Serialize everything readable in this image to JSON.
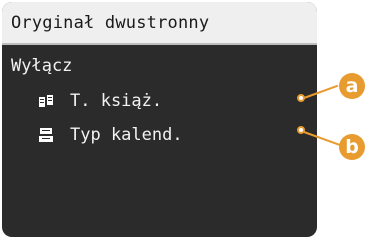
{
  "screen": {
    "title": "Oryginał dwustronny",
    "current_value": "Wyłącz",
    "options": [
      {
        "label": "T. książ.",
        "icon": "book-type-icon"
      },
      {
        "label": "Typ kalend.",
        "icon": "calendar-type-icon"
      }
    ]
  },
  "callouts": {
    "a": "a",
    "b": "b"
  },
  "colors": {
    "screen_bg": "#2b2b2b",
    "titlebar_bg": "#efefef",
    "callout": "#e89b2f"
  }
}
